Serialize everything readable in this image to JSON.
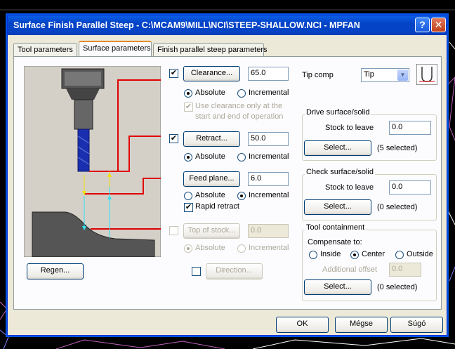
{
  "window": {
    "title": "Surface Finish Parallel Steep - C:\\MCAM9\\MILL\\NCI\\STEEP-SHALLOW.NCI - MPFAN",
    "help_glyph": "?",
    "close_glyph": "✕"
  },
  "tabs": [
    {
      "label": "Tool parameters"
    },
    {
      "label": "Surface parameters"
    },
    {
      "label": "Finish parallel steep parameters"
    }
  ],
  "clearance": {
    "label": "Clearance...",
    "value": "65.0",
    "checked_glyph": "✔",
    "absolute": "Absolute",
    "incremental": "Incremental",
    "use_only_line1": "Use clearance only at the",
    "use_only_line2": "start and end of operation"
  },
  "retract": {
    "label": "Retract...",
    "value": "50.0",
    "checked_glyph": "✔",
    "absolute": "Absolute",
    "incremental": "Incremental"
  },
  "feed_plane": {
    "label": "Feed plane...",
    "value": "6.0",
    "absolute": "Absolute",
    "incremental": "Incremental",
    "rapid_retract": "Rapid retract",
    "checked_glyph": "✔"
  },
  "top_of_stock": {
    "label": "Top of stock...",
    "value": "0.0",
    "absolute": "Absolute",
    "incremental": "Incremental"
  },
  "regen": {
    "label": "Regen..."
  },
  "direction": {
    "label": "Direction..."
  },
  "tip_comp": {
    "label": "Tip comp",
    "value": "Tip",
    "arrow": "▼"
  },
  "drive": {
    "title": "Drive surface/solid",
    "stock_label": "Stock to leave",
    "stock_value": "0.0",
    "select_label": "Select...",
    "selected": "(5  selected)"
  },
  "check": {
    "title": "Check surface/solid",
    "stock_label": "Stock to leave",
    "stock_value": "0.0",
    "select_label": "Select...",
    "selected": "(0  selected)"
  },
  "containment": {
    "title": "Tool containment",
    "compensate_label": "Compensate to:",
    "inside": "Inside",
    "center": "Center",
    "outside": "Outside",
    "offset_label": "Additional offset",
    "offset_value": "0.0",
    "select_label": "Select...",
    "selected": "(0  selected)"
  },
  "footer": {
    "ok": "OK",
    "cancel": "Mégse",
    "help": "Súgó"
  },
  "colors": {
    "title_bar": "#0543c6",
    "dialog_bg": "#ece9d8",
    "tab_accent": "#e68b2c",
    "diagram_lines": "#e00000"
  }
}
